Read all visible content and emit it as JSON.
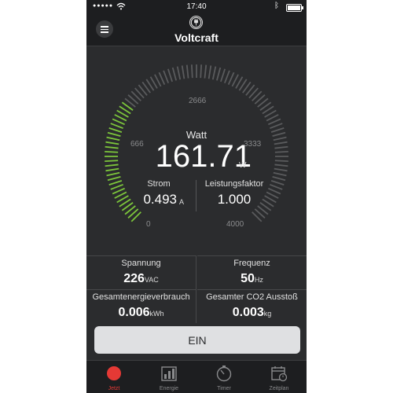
{
  "status_bar": {
    "time": "17:40"
  },
  "nav": {
    "title": "Voltcraft"
  },
  "gauge": {
    "label": "Watt",
    "value": "161.71",
    "unit": "W",
    "max": 4000,
    "fill_fraction": 0.3,
    "tick_labels": [
      "0",
      "666",
      "2666",
      "3333",
      "4000"
    ],
    "current": {
      "label": "Strom",
      "value": "0.493",
      "unit": "A"
    },
    "power_factor": {
      "label": "Leistungsfaktor",
      "value": "1.000"
    }
  },
  "stats": {
    "voltage": {
      "label": "Spannung",
      "value": "226",
      "unit": "VAC"
    },
    "frequency": {
      "label": "Frequenz",
      "value": "50",
      "unit": "Hz"
    },
    "energy": {
      "label": "Gesamtenergieverbrauch",
      "value": "0.006",
      "unit": "kWh"
    },
    "co2": {
      "label": "Gesamter CO2 Ausstoß",
      "value": "0.003",
      "unit": "kg"
    }
  },
  "switch_button": {
    "label": "EIN"
  },
  "tabs": [
    {
      "label": "Jetzt",
      "icon": "power-dot-icon",
      "active": true
    },
    {
      "label": "Energie",
      "icon": "bar-chart-icon",
      "active": false
    },
    {
      "label": "Timer",
      "icon": "stopwatch-icon",
      "active": false
    },
    {
      "label": "Zeitplan",
      "icon": "calendar-icon",
      "active": false
    }
  ],
  "colors": {
    "background": "#2b2c2e",
    "bar": "#1d1e20",
    "gauge_active": "#7cc63b",
    "gauge_inactive": "#5a5b5d",
    "active_tab": "#e53935",
    "button": "#dfe0e2"
  }
}
